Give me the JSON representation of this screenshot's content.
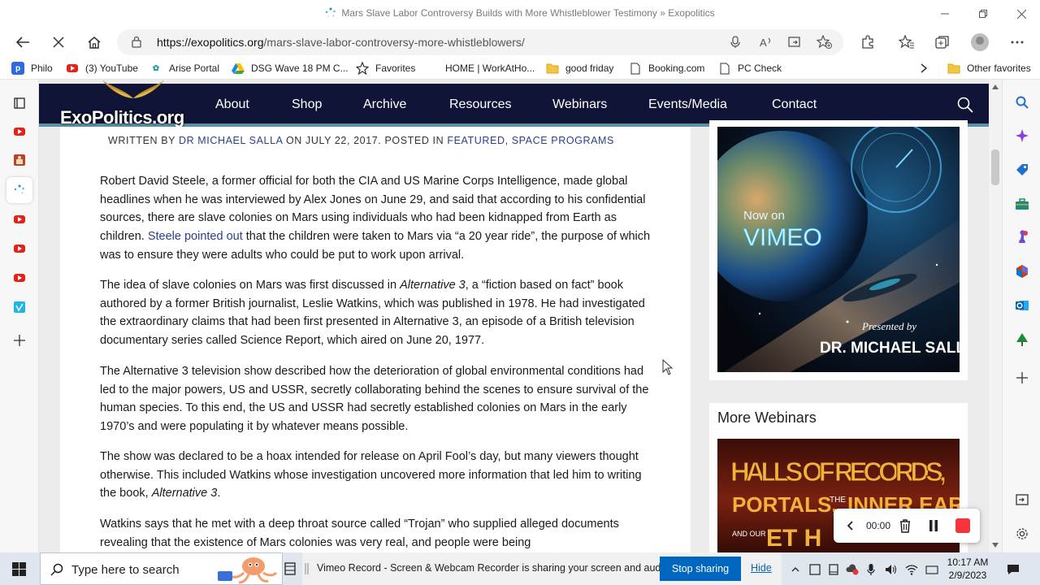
{
  "browser": {
    "window_title": "Mars Slave Labor Controversy Builds with More Whistleblower Testimony » Exopolitics",
    "url_host": "https://exopolitics.org",
    "url_path": "/mars-slave-labor-controversy-more-whistleblowers/",
    "favorites": [
      {
        "label": "Philo"
      },
      {
        "label": "(3) YouTube"
      },
      {
        "label": "Arise Portal"
      },
      {
        "label": "DSG Wave 18 PM C..."
      },
      {
        "label": "Favorites"
      },
      {
        "label": "HOME | WorkAtHo..."
      },
      {
        "label": "good friday"
      },
      {
        "label": "Booking.com"
      },
      {
        "label": "PC Check"
      }
    ],
    "other_favorites": "Other favorites"
  },
  "site": {
    "logo_text": "ExoPolitics.org",
    "menu": [
      "About",
      "Shop",
      "Archive",
      "Resources",
      "Webinars",
      "Events/Media",
      "Contact"
    ]
  },
  "article": {
    "byline_prefix": "WRITTEN BY",
    "author": "DR MICHAEL SALLA",
    "date_text": "ON JULY 22, 2017. POSTED IN",
    "category1": "FEATURED",
    "category2": "SPACE PROGRAMS",
    "p1_a": "Robert David Steele, a former official for both the CIA and US Marine Corps Intelligence, made global headlines when he was interviewed by Alex Jones on June 29, and said that according to his confidential sources, there are slave colonies on Mars using individuals who had been kidnapped from Earth as children.",
    "p1_link": "Steele pointed out",
    "p1_b": "that the children were taken to Mars via “a 20 year ride”, the purpose of which was to ensure they were adults who could be put to work upon arrival.",
    "p2_a": "The idea of slave colonies on Mars was first discussed in",
    "p2_em": "Alternative 3",
    "p2_b": ", a “fiction based on fact” book authored by a former British journalist, Leslie Watkins, which was published in 1978. He had investigated the extraordinary claims that had been first presented in Alternative 3, an episode of a British television documentary series called Science Report, which aired on June 20, 1977.",
    "p3": "The Alternative 3 television show described how the deterioration of global environmental conditions had led to the major powers, US and USSR, secretly collaborating behind the scenes to ensure survival of the human species. To this end, the US and USSR had secretly established colonies on Mars in the early 1970’s and were populating it by whatever means possible.",
    "p4_a": "The show was declared to be a hoax intended for release on April Fool’s day, but many viewers thought otherwise. This included Watkins whose investigation uncovered more information that led him to writing the book,",
    "p4_em": "Alternative 3",
    "p4_b": ".",
    "p5": "Watkins says that he met with a deep throat source called “Trojan” who supplied alleged documents revealing that the existence of Mars colonies was very real, and people were being"
  },
  "sidebar": {
    "vimeo_now_on": "Now on",
    "vimeo_brand": "VIMEO",
    "vimeo_presented": "Presented by",
    "vimeo_author": "DR. MICHAEL SALLA",
    "more_webinars_title": "More Webinars",
    "halls_line1": "HALLS OF RECORDS,",
    "halls_line2": "PORTALS,",
    "halls_the": "THE",
    "halls_line2b": "INNER EARTH",
    "halls_andour": "AND OUR",
    "halls_line3": "ET H"
  },
  "recorder": {
    "time": "00:00"
  },
  "taskbar": {
    "search_placeholder": "Type here to search",
    "share_message": "Vimeo Record - Screen & Webcam Recorder is sharing your screen and audio.",
    "stop_sharing": "Stop sharing",
    "hide": "Hide",
    "time": "10:17 AM",
    "date": "2/9/2023"
  }
}
